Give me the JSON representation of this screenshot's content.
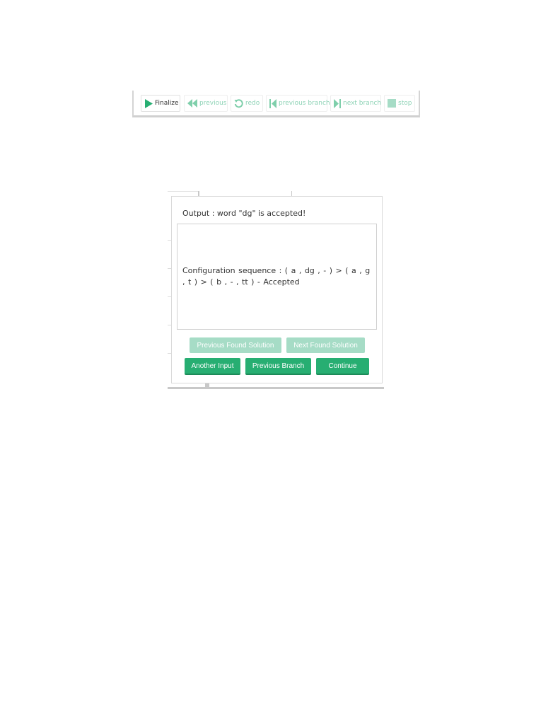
{
  "toolbar": {
    "buttons": [
      {
        "label": "Finalize",
        "icon": "play-icon",
        "enabled": true
      },
      {
        "label": "previous",
        "icon": "rewind-icon",
        "enabled": false
      },
      {
        "label": "redo",
        "icon": "redo-icon",
        "enabled": false
      },
      {
        "label": "previous branch",
        "icon": "skip-back-icon",
        "enabled": false
      },
      {
        "label": "next branch",
        "icon": "skip-forward-icon",
        "enabled": false
      },
      {
        "label": "stop",
        "icon": "stop-icon",
        "enabled": false
      }
    ]
  },
  "dialog": {
    "output_text": "Output  : word \"dg\" is  accepted!",
    "config_text": "Configuration sequence : ( a , dg ,  -  )  > ( a , g , t )  > ( b ,  -  , tt )  - Accepted",
    "buttons": {
      "previous_found_solution": "Previous Found Solution",
      "next_found_solution": "Next Found Solution",
      "another_input": "Another Input",
      "previous_branch": "Previous Branch",
      "continue": "Continue"
    }
  },
  "colors": {
    "accent": "#27ae72",
    "accent_disabled": "#a6dcc6",
    "toolbar_disabled_text": "#8ed3b6"
  }
}
